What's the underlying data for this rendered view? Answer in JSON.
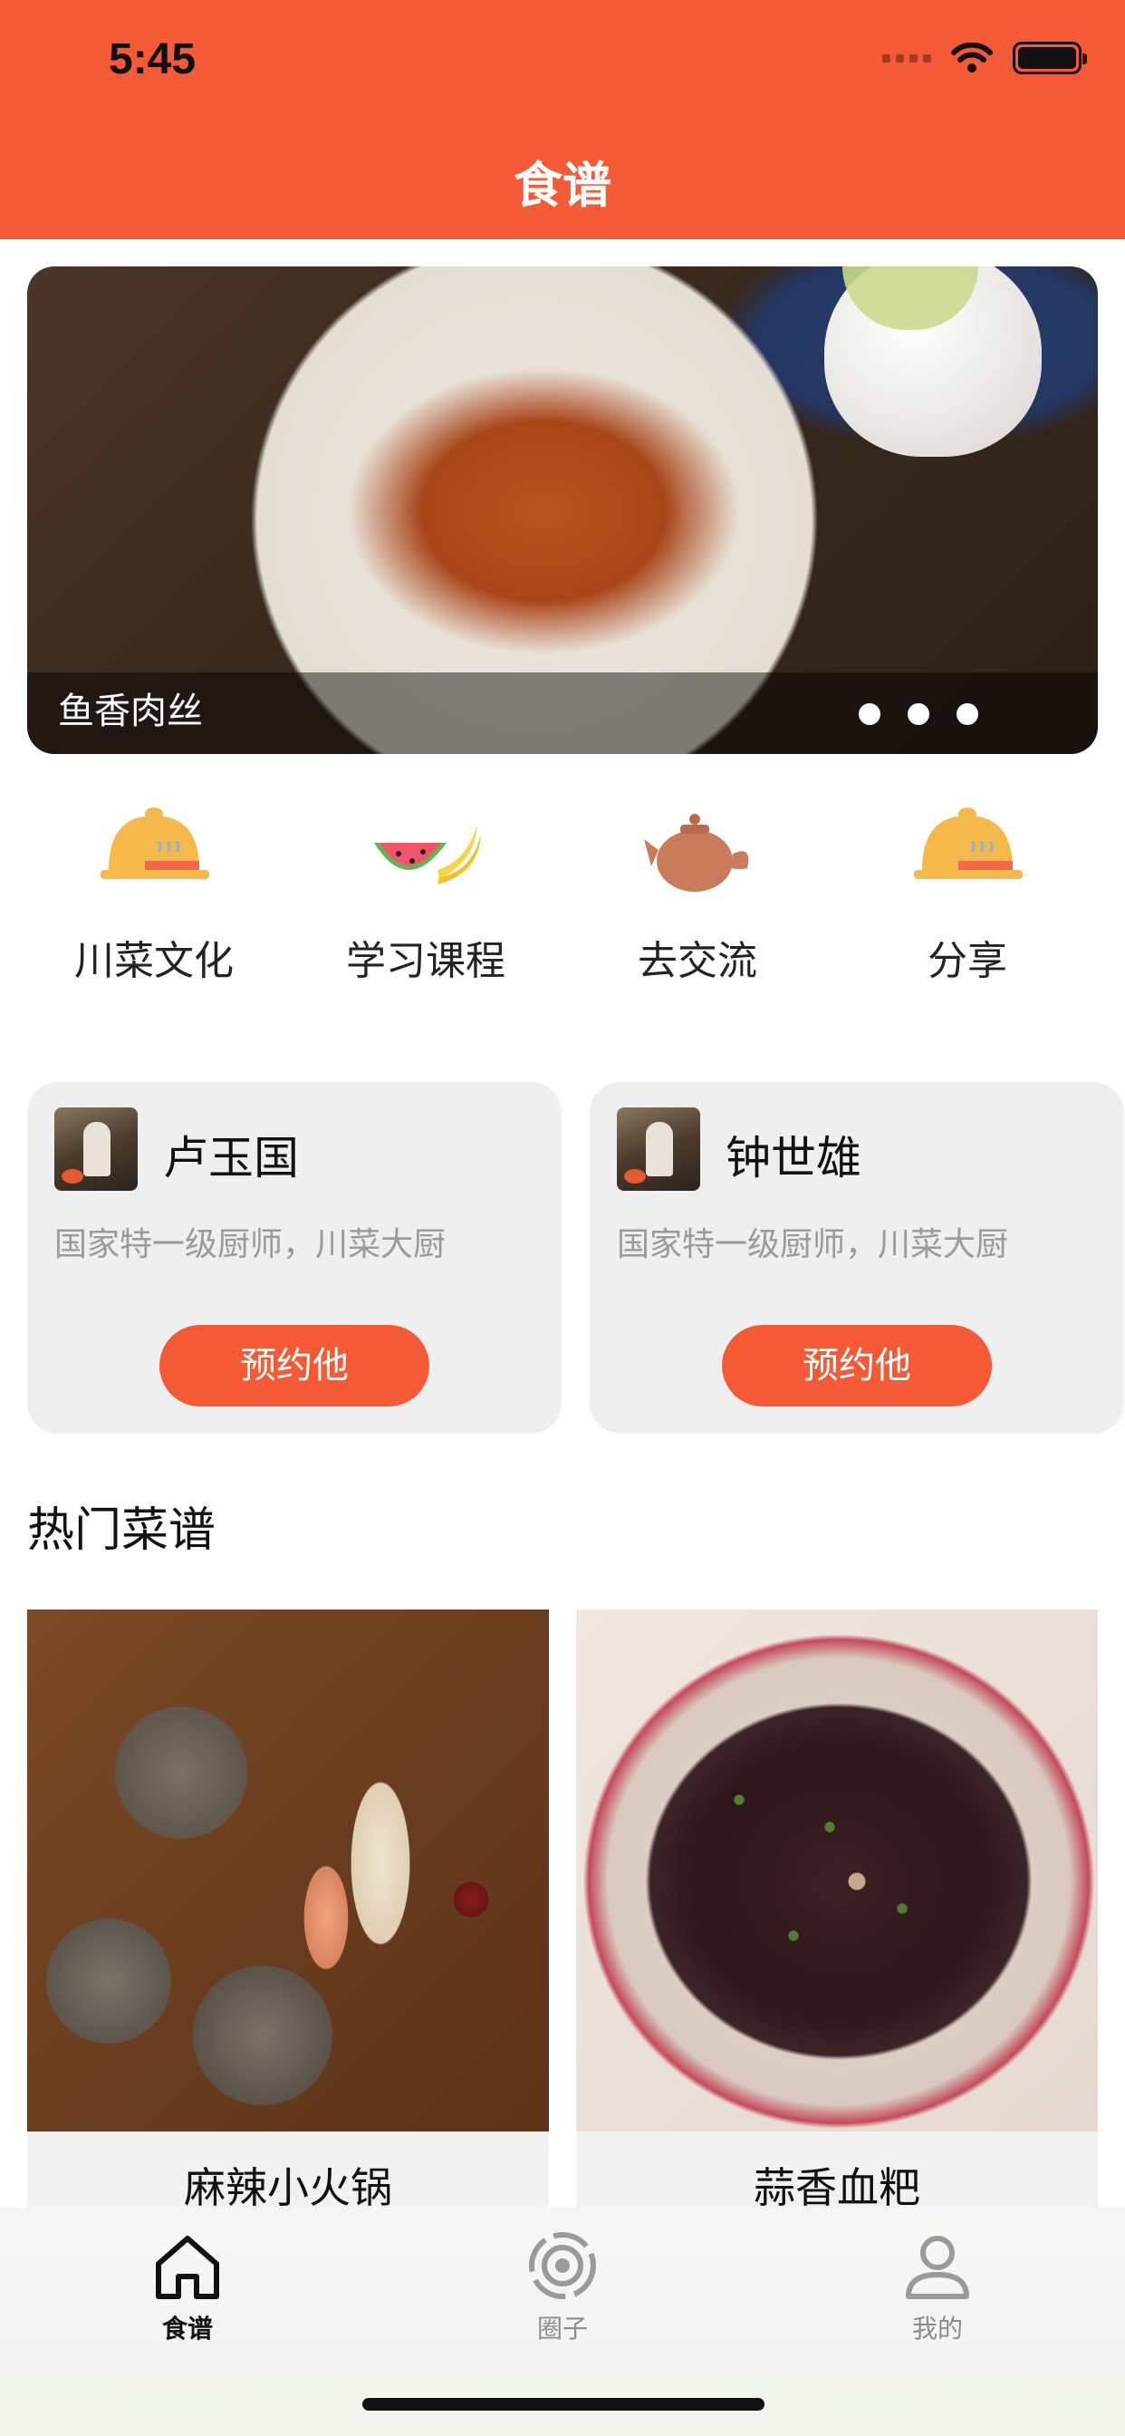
{
  "status_bar": {
    "time": "5:45"
  },
  "header": {
    "title": "食谱"
  },
  "banner": {
    "caption": "鱼香肉丝"
  },
  "categories": [
    {
      "label": "川菜文化",
      "icon": "serving-cloche-icon"
    },
    {
      "label": "学习课程",
      "icon": "fruit-icon"
    },
    {
      "label": "去交流",
      "icon": "teapot-icon"
    },
    {
      "label": "分享",
      "icon": "serving-cloche-icon"
    }
  ],
  "chefs": [
    {
      "name": "卢玉国",
      "desc": "国家特一级厨师，川菜大厨",
      "button": "预约他"
    },
    {
      "name": "钟世雄",
      "desc": "国家特一级厨师，川菜大厨",
      "button": "预约他"
    }
  ],
  "hot_section": {
    "title": "热门菜谱"
  },
  "dishes": [
    {
      "name": "麻辣小火锅"
    },
    {
      "name": "蒜香血粑"
    }
  ],
  "tabbar": [
    {
      "label": "食谱",
      "active": true
    },
    {
      "label": "圈子",
      "active": false
    },
    {
      "label": "我的",
      "active": false
    }
  ],
  "colors": {
    "primary": "#F55A36",
    "card_bg": "#efefef",
    "muted_text": "#9a9a9a"
  }
}
